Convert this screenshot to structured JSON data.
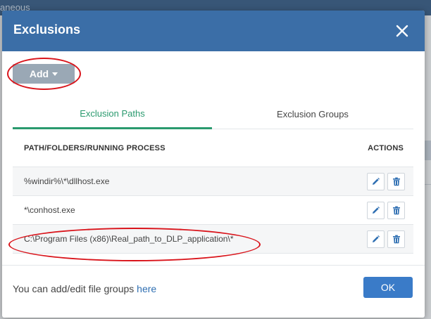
{
  "background": {
    "header_text": "aneous"
  },
  "dialog": {
    "title": "Exclusions",
    "add_button_label": "Add",
    "tabs": [
      {
        "label": "Exclusion Paths",
        "active": true
      },
      {
        "label": "Exclusion Groups",
        "active": false
      }
    ],
    "table": {
      "headers": {
        "path": "PATH/FOLDERS/RUNNING PROCESS",
        "actions": "ACTIONS"
      },
      "rows": [
        {
          "path": "%windir%\\*\\dllhost.exe"
        },
        {
          "path": "*\\conhost.exe"
        },
        {
          "path": "C:\\Program Files (x86)\\Real_path_to_DLP_application\\*"
        }
      ]
    },
    "footer": {
      "text": "You can add/edit file groups",
      "link_label": "here",
      "ok_label": "OK"
    }
  },
  "colors": {
    "header_blue": "#3b6ea7",
    "tab_active_green": "#2a9a6e",
    "ok_blue": "#3a7bc8",
    "annotation_red": "#d9141b",
    "icon_blue": "#2f6fb2"
  }
}
